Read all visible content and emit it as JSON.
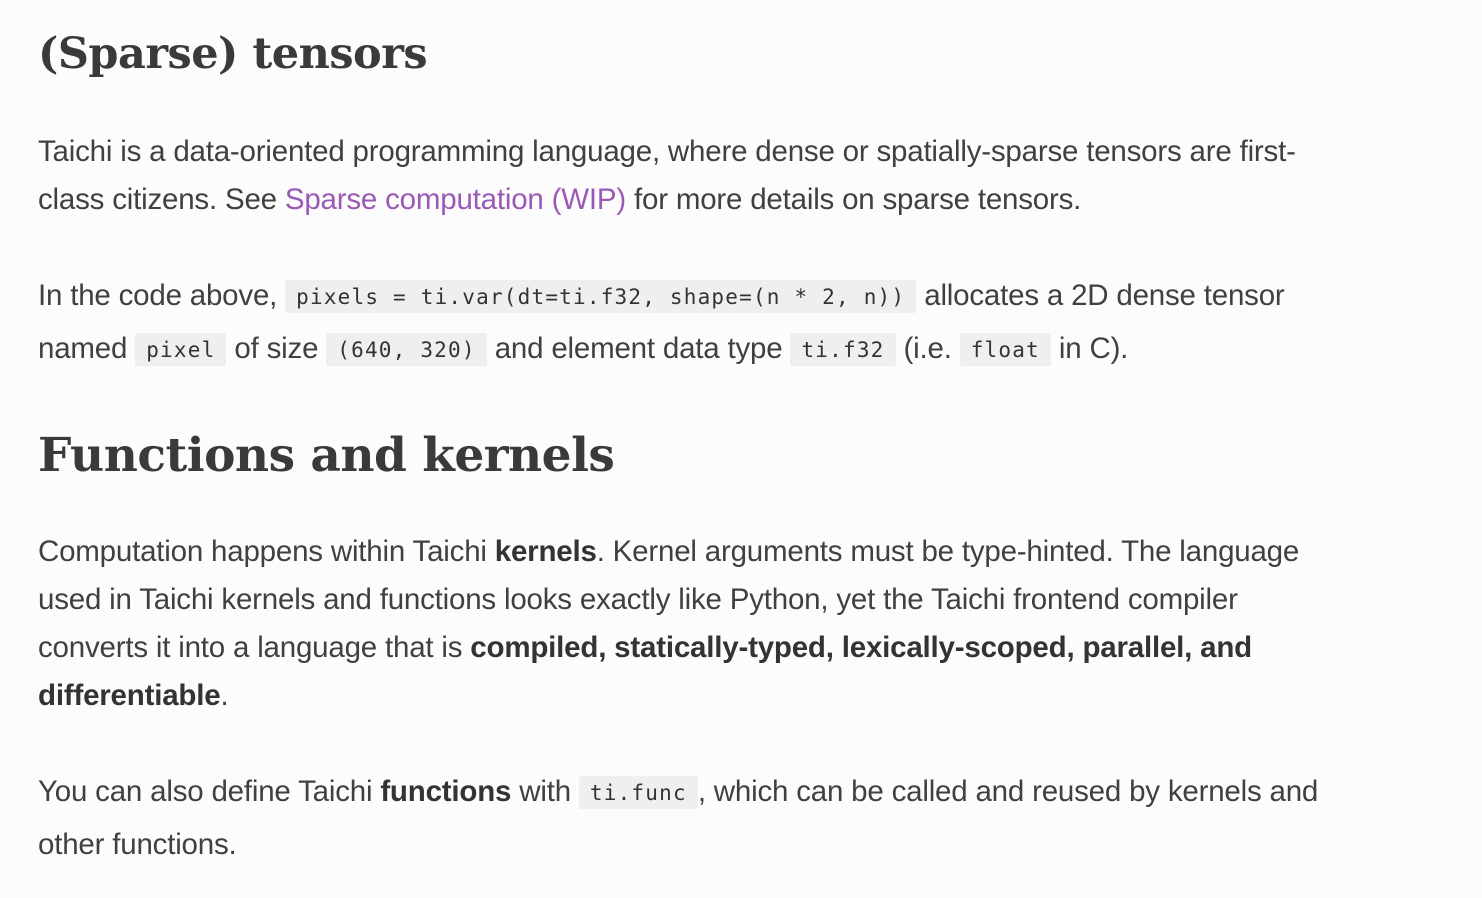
{
  "section_sparse": {
    "heading": "(Sparse) tensors",
    "para1": {
      "line1": "Taichi is a data-oriented programming language, where dense or spatially-sparse tensors are first-",
      "line2_pre": "class citizens. See ",
      "link": "Sparse computation (WIP)",
      "line2_post": " for more details on sparse tensors."
    },
    "para2": {
      "t1": "In the code above, ",
      "code1": "pixels = ti.var(dt=ti.f32, shape=(n * 2, n))",
      "t2": " allocates a 2D dense tensor",
      "t3": "named ",
      "code2": "pixel",
      "t4": " of size ",
      "code3": "(640, 320)",
      "t5": " and element data type ",
      "code4": "ti.f32",
      "t6": " (i.e. ",
      "code5": "float",
      "t7": " in C)."
    }
  },
  "section_functions": {
    "heading": "Functions and kernels",
    "para3": {
      "t1": "Computation happens within Taichi ",
      "b1": "kernels",
      "t2": ". Kernel arguments must be type-hinted. The language",
      "line2": "used in Taichi kernels and functions looks exactly like Python, yet the Taichi frontend compiler",
      "t3": "converts it into a language that is ",
      "b2": "compiled, statically-typed, lexically-scoped, parallel, and",
      "b3": "differentiable",
      "t4": "."
    },
    "para4": {
      "t1": "You can also define Taichi ",
      "b1": "functions",
      "t2": " with ",
      "code1": "ti.func",
      "t3": ", which can be called and reused by kernels and",
      "line2": "other functions."
    }
  }
}
